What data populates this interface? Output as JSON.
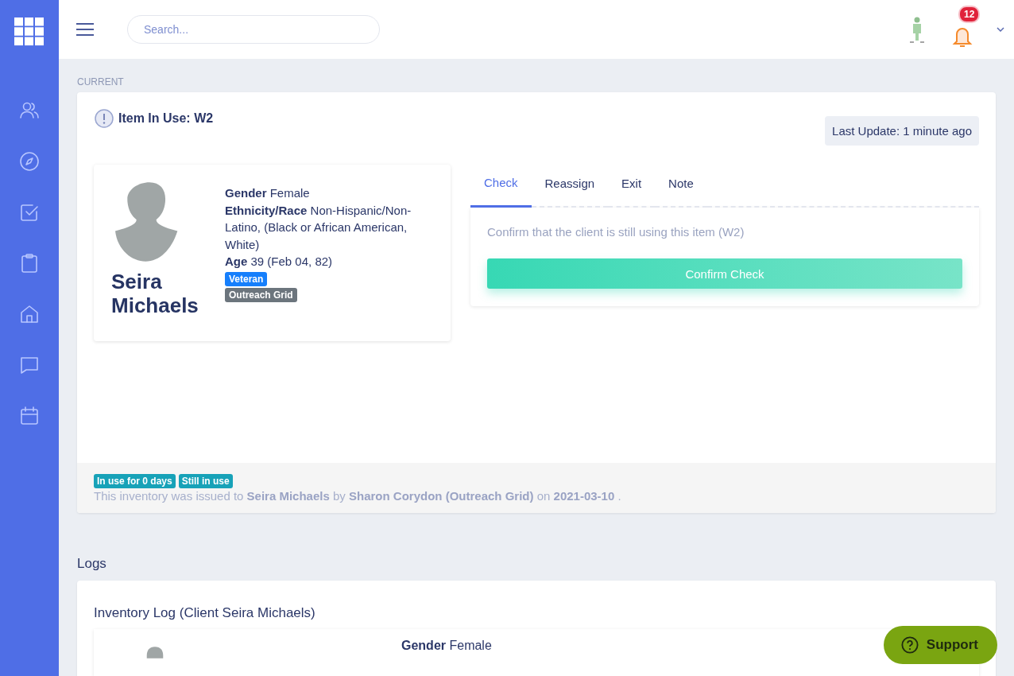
{
  "topbar": {
    "search": {
      "placeholder": "Search..."
    },
    "notifications": {
      "count": "12"
    }
  },
  "current": {
    "section_label": "CURRENT",
    "title": "Item In Use: W2",
    "last_update": "Last Update: 1 minute ago",
    "client": {
      "name": "Seira Michaels",
      "fields": [
        {
          "label": "Gender",
          "value": "Female"
        },
        {
          "label": "Ethnicity/Race",
          "value": "Non-Hispanic/Non-Latino, (Black or African American, White)"
        },
        {
          "label": "Age",
          "value": "39 (Feb 04, 82)"
        }
      ],
      "tags": [
        {
          "label": "Veteran",
          "color": "#167ffc"
        },
        {
          "label": "Outreach Grid",
          "color": "#6c757d"
        }
      ]
    },
    "tabs": [
      {
        "label": "Check",
        "selected": true
      },
      {
        "label": "Reassign",
        "selected": false
      },
      {
        "label": "Exit",
        "selected": false
      },
      {
        "label": "Note",
        "selected": false
      }
    ],
    "check_panel": {
      "prompt": "Confirm that the client is still using this item (W2)",
      "button": "Confirm Check"
    },
    "footer": {
      "badges": [
        "In use for 0 days",
        "Still in use"
      ],
      "sentence": "This inventory was issued to **Seira Michaels** by **Sharon Corydon (Outreach Grid)** on **2021-03-10** ."
    }
  },
  "logs": {
    "heading": "Logs",
    "card_title": "Inventory Log (Client Seira Michaels)",
    "fields": [
      {
        "label": "Gender",
        "value": "Female"
      }
    ]
  },
  "support_button": "Support"
}
